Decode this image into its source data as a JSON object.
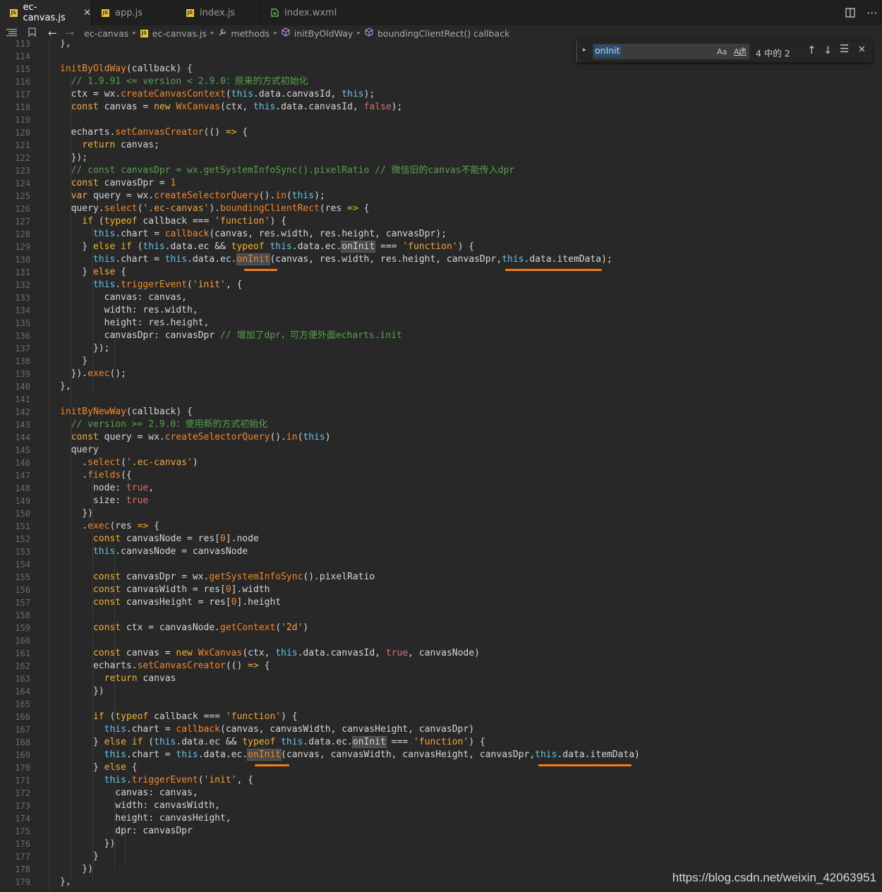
{
  "tabs": [
    {
      "label": "ec-canvas.js",
      "icon": "js-file-icon",
      "active": true
    },
    {
      "label": "app.js",
      "icon": "js-file-icon",
      "active": false
    },
    {
      "label": "index.js",
      "icon": "js-file-icon",
      "active": false
    },
    {
      "label": "index.wxml",
      "icon": "wxml-file-icon",
      "active": false
    }
  ],
  "breadcrumb": [
    "ec-canvas",
    "ec-canvas.js",
    "methods",
    "initByOldWay",
    "boundingClientRect() callback"
  ],
  "find": {
    "query": "onInit",
    "count": "4 中的 2",
    "opt_case": "Aa",
    "opt_word": "Abl",
    "opt_regex": ".*"
  },
  "watermark": "https://blog.csdn.net/weixin_42063951",
  "lines": [
    {
      "n": "113",
      "html": "    },"
    },
    {
      "n": "114",
      "html": ""
    },
    {
      "n": "115",
      "html": "    <span class='f'>initByOldWay</span>(callback) {"
    },
    {
      "n": "116",
      "html": "      <span class='c'>// 1.9.91 &lt;= version &lt; 2.9.0：原来的方式初始化</span>"
    },
    {
      "n": "117",
      "html": "      ctx = wx.<span class='f'>createCanvasContext</span>(<span class='t'>this</span>.data.canvasId, <span class='t'>this</span>);"
    },
    {
      "n": "118",
      "html": "      <span class='k'>const</span> canvas = <span class='k'>new</span> <span class='f'>WxCanvas</span>(ctx, <span class='t'>this</span>.data.canvasId, <span class='p'>false</span>);"
    },
    {
      "n": "119",
      "html": ""
    },
    {
      "n": "120",
      "html": "      echarts.<span class='f'>setCanvasCreator</span>(() <span class='k'>=&gt;</span> {"
    },
    {
      "n": "121",
      "html": "        <span class='k'>return</span> canvas;"
    },
    {
      "n": "122",
      "html": "      });"
    },
    {
      "n": "123",
      "html": "      <span class='c'>// const canvasDpr = wx.getSystemInfoSync().pixelRatio // 微信旧的canvas不能传入dpr</span>"
    },
    {
      "n": "124",
      "html": "      <span class='k'>const</span> canvasDpr = <span class='n'>1</span>"
    },
    {
      "n": "125",
      "html": "      <span class='k'>var</span> query = wx.<span class='f'>createSelectorQuery</span>().<span class='f'>in</span>(<span class='t'>this</span>);"
    },
    {
      "n": "126",
      "html": "      query.<span class='f'>select</span>(<span class='s'>'.ec-canvas'</span>).<span class='f'>boundingClientRect</span>(res <span class='k'>=&gt;</span> {"
    },
    {
      "n": "127",
      "html": "        <span class='k'>if</span> (<span class='k'>typeof</span> callback === <span class='s'>'function'</span>) {"
    },
    {
      "n": "128",
      "html": "          <span class='t'>this</span>.chart = <span class='f'>callback</span>(canvas, res.width, res.height, canvasDpr);"
    },
    {
      "n": "129",
      "html": "        } <span class='k'>else if</span> (<span class='t'>this</span>.data.ec &amp;&amp; <span class='k'>typeof</span> <span class='t'>this</span>.data.ec.<span class='hl'>onInit</span> === <span class='s'>'function'</span>) {"
    },
    {
      "n": "130",
      "html": "          <span class='t'>this</span>.chart = <span class='t'>this</span>.data.ec.<span class='f hl'>onInit</span>(canvas, res.width, res.height, canvasDpr,<span class='t'>this</span>.data.itemData);"
    },
    {
      "n": "131",
      "html": "        } <span class='k'>else</span> {"
    },
    {
      "n": "132",
      "html": "          <span class='t'>this</span>.<span class='f'>triggerEvent</span>(<span class='s'>'init'</span>, {"
    },
    {
      "n": "133",
      "html": "            canvas: canvas,"
    },
    {
      "n": "134",
      "html": "            width: res.width,"
    },
    {
      "n": "135",
      "html": "            height: res.height,"
    },
    {
      "n": "136",
      "html": "            canvasDpr: canvasDpr <span class='c'>// 增加了dpr，可方便外面echarts.init</span>"
    },
    {
      "n": "137",
      "html": "          });"
    },
    {
      "n": "138",
      "html": "        }"
    },
    {
      "n": "139",
      "html": "      }).<span class='f'>exec</span>();"
    },
    {
      "n": "140",
      "html": "    },"
    },
    {
      "n": "141",
      "html": ""
    },
    {
      "n": "142",
      "html": "    <span class='f'>initByNewWay</span>(callback) {"
    },
    {
      "n": "143",
      "html": "      <span class='c'>// version &gt;= 2.9.0：使用新的方式初始化</span>"
    },
    {
      "n": "144",
      "html": "      <span class='k'>const</span> query = wx.<span class='f'>createSelectorQuery</span>().<span class='f'>in</span>(<span class='t'>this</span>)"
    },
    {
      "n": "145",
      "html": "      query"
    },
    {
      "n": "146",
      "html": "        .<span class='f'>select</span>(<span class='s'>'.ec-canvas'</span>)"
    },
    {
      "n": "147",
      "html": "        .<span class='f'>fields</span>({"
    },
    {
      "n": "148",
      "html": "          node: <span class='p'>true</span>,"
    },
    {
      "n": "149",
      "html": "          size: <span class='p'>true</span>"
    },
    {
      "n": "150",
      "html": "        })"
    },
    {
      "n": "151",
      "html": "        .<span class='f'>exec</span>(res <span class='k'>=&gt;</span> {"
    },
    {
      "n": "152",
      "html": "          <span class='k'>const</span> canvasNode = res[<span class='n'>0</span>].node"
    },
    {
      "n": "153",
      "html": "          <span class='t'>this</span>.canvasNode = canvasNode"
    },
    {
      "n": "154",
      "html": ""
    },
    {
      "n": "155",
      "html": "          <span class='k'>const</span> canvasDpr = wx.<span class='f'>getSystemInfoSync</span>().pixelRatio"
    },
    {
      "n": "156",
      "html": "          <span class='k'>const</span> canvasWidth = res[<span class='n'>0</span>].width"
    },
    {
      "n": "157",
      "html": "          <span class='k'>const</span> canvasHeight = res[<span class='n'>0</span>].height"
    },
    {
      "n": "158",
      "html": ""
    },
    {
      "n": "159",
      "html": "          <span class='k'>const</span> ctx = canvasNode.<span class='f'>getContext</span>(<span class='s'>'2d'</span>)"
    },
    {
      "n": "160",
      "html": ""
    },
    {
      "n": "161",
      "html": "          <span class='k'>const</span> canvas = <span class='k'>new</span> <span class='f'>WxCanvas</span>(ctx, <span class='t'>this</span>.data.canvasId, <span class='p'>true</span>, canvasNode)"
    },
    {
      "n": "162",
      "html": "          echarts.<span class='f'>setCanvasCreator</span>(() <span class='k'>=&gt;</span> {"
    },
    {
      "n": "163",
      "html": "            <span class='k'>return</span> canvas"
    },
    {
      "n": "164",
      "html": "          })"
    },
    {
      "n": "165",
      "html": ""
    },
    {
      "n": "166",
      "html": "          <span class='k'>if</span> (<span class='k'>typeof</span> callback === <span class='s'>'function'</span>) {"
    },
    {
      "n": "167",
      "html": "            <span class='t'>this</span>.chart = <span class='f'>callback</span>(canvas, canvasWidth, canvasHeight, canvasDpr)"
    },
    {
      "n": "168",
      "html": "          } <span class='k'>else if</span> (<span class='t'>this</span>.data.ec &amp;&amp; <span class='k'>typeof</span> <span class='t'>this</span>.data.ec.<span class='hl'>onInit</span> === <span class='s'>'function'</span>) {"
    },
    {
      "n": "169",
      "html": "            <span class='t'>this</span>.chart = <span class='t'>this</span>.data.ec.<span class='f hl'>onInit</span>(canvas, canvasWidth, canvasHeight, canvasDpr,<span class='t'>this</span>.data.itemData)"
    },
    {
      "n": "170",
      "html": "          } <span class='k'>else</span> {"
    },
    {
      "n": "171",
      "html": "            <span class='t'>this</span>.<span class='f'>triggerEvent</span>(<span class='s'>'init'</span>, {"
    },
    {
      "n": "172",
      "html": "              canvas: canvas,"
    },
    {
      "n": "173",
      "html": "              width: canvasWidth,"
    },
    {
      "n": "174",
      "html": "              height: canvasHeight,"
    },
    {
      "n": "175",
      "html": "              dpr: canvasDpr"
    },
    {
      "n": "176",
      "html": "            })"
    },
    {
      "n": "177",
      "html": "          }"
    },
    {
      "n": "178",
      "html": "        })"
    },
    {
      "n": "179",
      "html": "    },"
    }
  ]
}
